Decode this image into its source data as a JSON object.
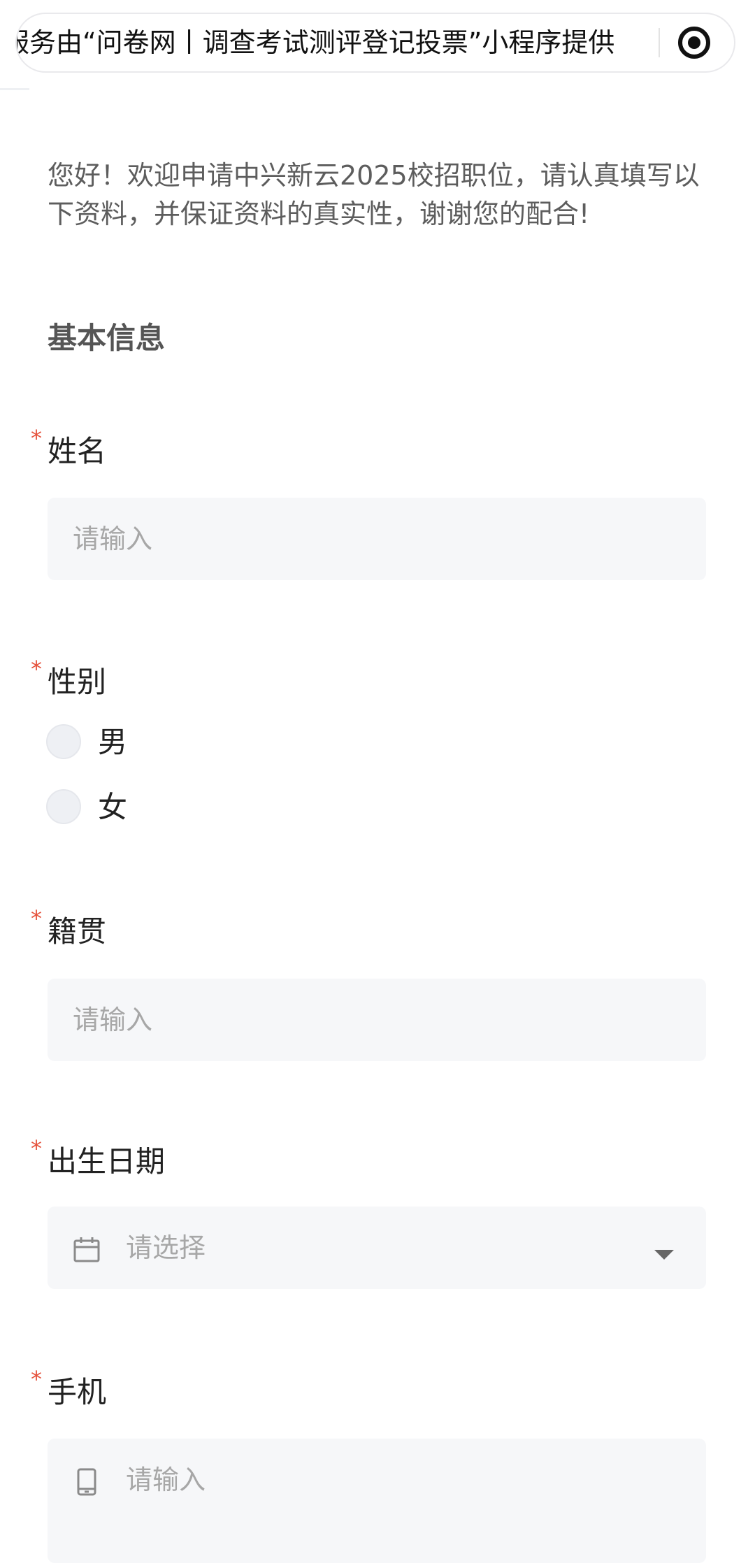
{
  "banner": {
    "notice": "服务由“问卷网丨调查考试测评登记投票”小程序提供"
  },
  "intro": {
    "text": "您好！欢迎申请中兴新云2025校招职位，请认真填写以下资料，并保证资料的真实性，谢谢您的配合!"
  },
  "section": {
    "title": "基本信息"
  },
  "form": {
    "required_mark": "*",
    "name": {
      "label": "姓名",
      "placeholder": "请输入"
    },
    "gender": {
      "label": "性别",
      "options": [
        "男",
        "女"
      ]
    },
    "native_place": {
      "label": "籍贯",
      "placeholder": "请输入"
    },
    "birth_date": {
      "label": "出生日期",
      "placeholder": "请选择",
      "icon": "calendar-icon"
    },
    "phone": {
      "label": "手机",
      "placeholder": "请输入",
      "icon": "phone-icon"
    }
  },
  "colors": {
    "required": "#e5513b",
    "field_bg": "#f6f7f9",
    "placeholder": "#a7a7a7"
  }
}
